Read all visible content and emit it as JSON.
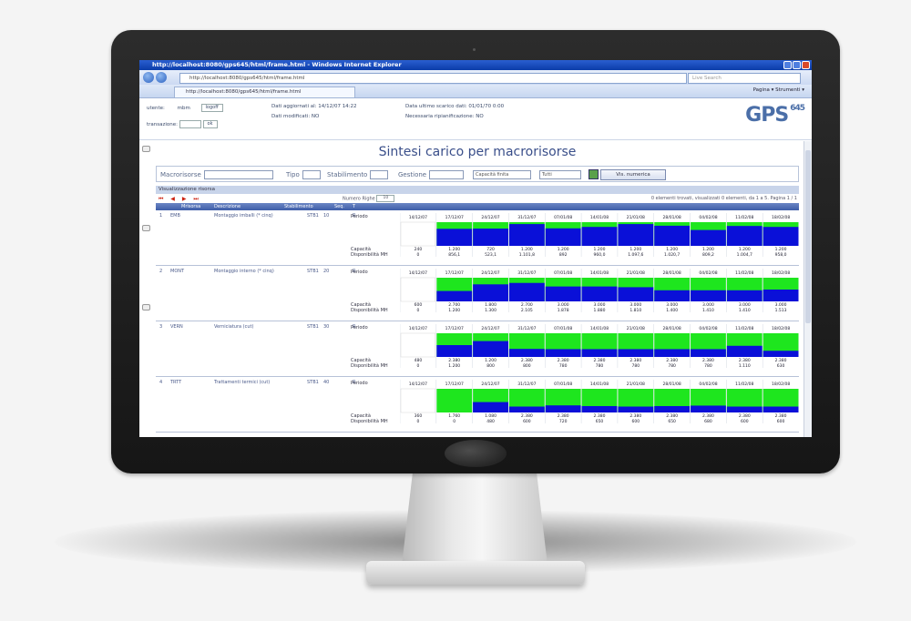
{
  "window": {
    "title": "http://localhost:8080/gps645/html/frame.html - Windows Internet Explorer",
    "address": "http://localhost:8080/gps645/html/frame.html",
    "search_placeholder": "Live Search",
    "tab_label": "http://localhost:8080/gps645/html/frame.html",
    "commands": "Pagina ▾  Strumenti ▾"
  },
  "header": {
    "utente_label": "utente:",
    "utente_value": "mbm",
    "logout_label": "logoff",
    "transazione_label": "transazione:",
    "transazione_btn": "ok",
    "dati_aggiornati": "Dati aggiornati al: 14/12/07 14:22",
    "dati_modificati": "Dati modificati:  NO",
    "ultimo_scarico": "Data ultimo scarico dati:  01/01/70 0:00",
    "ripianificazione": "Necessaria ripianificazione: NO",
    "logo": "GPS",
    "logo_suffix": "645"
  },
  "page": {
    "title": "Sintesi carico per macrorisorse"
  },
  "filters": {
    "macrorisorsa_label": "Macrorisorse",
    "tipo_label": "Tipo",
    "stabilimento_label": "Stabilimento",
    "gestione_label": "Gestione",
    "select1": "Capacità finita",
    "select2": "Tutti",
    "button": "Vis. numerica"
  },
  "list": {
    "section_label": "Visualizzazione risorsa",
    "pager_arrows": "⏮ ◀ ▶ ⏭",
    "num_righe_label": "Numero Righe",
    "num_righe_btn": "10",
    "info": "0 elementi trovati, visualizzati 0 elementi, da 1 a 5. Pagina 1 / 1",
    "columns": [
      "Mrisorsa",
      "Descrizione",
      "Stabilimento",
      "Seq.",
      "T"
    ]
  },
  "row_labels": {
    "periodo": "Periodo",
    "capacita": "Capacità",
    "disponibilita": "Disponibilità MH"
  },
  "periods": [
    "14/12/07",
    "17/12/07",
    "24/12/07",
    "31/12/07",
    "07/01/08",
    "14/01/08",
    "21/01/08",
    "28/01/08",
    "04/02/08",
    "11/02/08",
    "18/02/08"
  ],
  "rows": [
    {
      "num": "1",
      "code": "EMB",
      "desc": "Montaggio imballi (* cinq)",
      "stab": "STB1",
      "seq": "10",
      "tipo": "R",
      "capacita": [
        "240",
        "1.200",
        "720",
        "1.200",
        "1.200",
        "1.200",
        "1.200",
        "1.200",
        "1.200",
        "1.200",
        "1.200"
      ],
      "disponibilita": [
        "0",
        "856,1",
        "523,1",
        "1.101,8",
        "892",
        "960,0",
        "1.097,6",
        "1.020,7",
        "809,2",
        "1.004,7",
        "958,0"
      ],
      "load": [
        0.0,
        0.72,
        0.73,
        0.92,
        0.74,
        0.8,
        0.92,
        0.85,
        0.67,
        0.84,
        0.8
      ]
    },
    {
      "num": "2",
      "code": "MONT",
      "desc": "Montaggio interno (* cinq)",
      "stab": "STB1",
      "seq": "20",
      "tipo": "R",
      "capacita": [
        "600",
        "2.700",
        "1.800",
        "2.700",
        "3.000",
        "3.000",
        "3.000",
        "3.000",
        "3.000",
        "3.000",
        "3.000"
      ],
      "disponibilita": [
        "0",
        "1.200",
        "1.300",
        "2.105",
        "1.878",
        "1.880",
        "1.810",
        "1.400",
        "1.410",
        "1.410",
        "1.513"
      ],
      "load": [
        0.0,
        0.44,
        0.72,
        0.78,
        0.63,
        0.63,
        0.6,
        0.47,
        0.47,
        0.47,
        0.5
      ]
    },
    {
      "num": "3",
      "code": "VERN",
      "desc": "Verniciatura (cut)",
      "stab": "STB1",
      "seq": "30",
      "tipo": "R",
      "capacita": [
        "480",
        "2.380",
        "1.200",
        "2.380",
        "2.380",
        "2.380",
        "2.380",
        "2.380",
        "2.380",
        "2.380",
        "2.380"
      ],
      "disponibilita": [
        "0",
        "1.200",
        "800",
        "800",
        "780",
        "780",
        "780",
        "780",
        "780",
        "1.110",
        "630"
      ],
      "load": [
        0.0,
        0.5,
        0.67,
        0.34,
        0.33,
        0.33,
        0.33,
        0.33,
        0.33,
        0.47,
        0.26
      ]
    },
    {
      "num": "4",
      "code": "TRTT",
      "desc": "Trattamenti termici (cut)",
      "stab": "STB1",
      "seq": "40",
      "tipo": "R",
      "capacita": [
        "360",
        "1.760",
        "1.080",
        "2.380",
        "2.380",
        "2.380",
        "2.380",
        "2.380",
        "2.380",
        "2.380",
        "2.380"
      ],
      "disponibilita": [
        "0",
        "0",
        "480",
        "600",
        "720",
        "650",
        "600",
        "650",
        "680",
        "600",
        "600"
      ],
      "load": [
        0.0,
        0.0,
        0.44,
        0.25,
        0.3,
        0.27,
        0.25,
        0.27,
        0.29,
        0.25,
        0.25
      ]
    }
  ],
  "colors": {
    "free": "#1ee61e",
    "load": "#0a10d8",
    "accent": "#3a4f8a"
  }
}
